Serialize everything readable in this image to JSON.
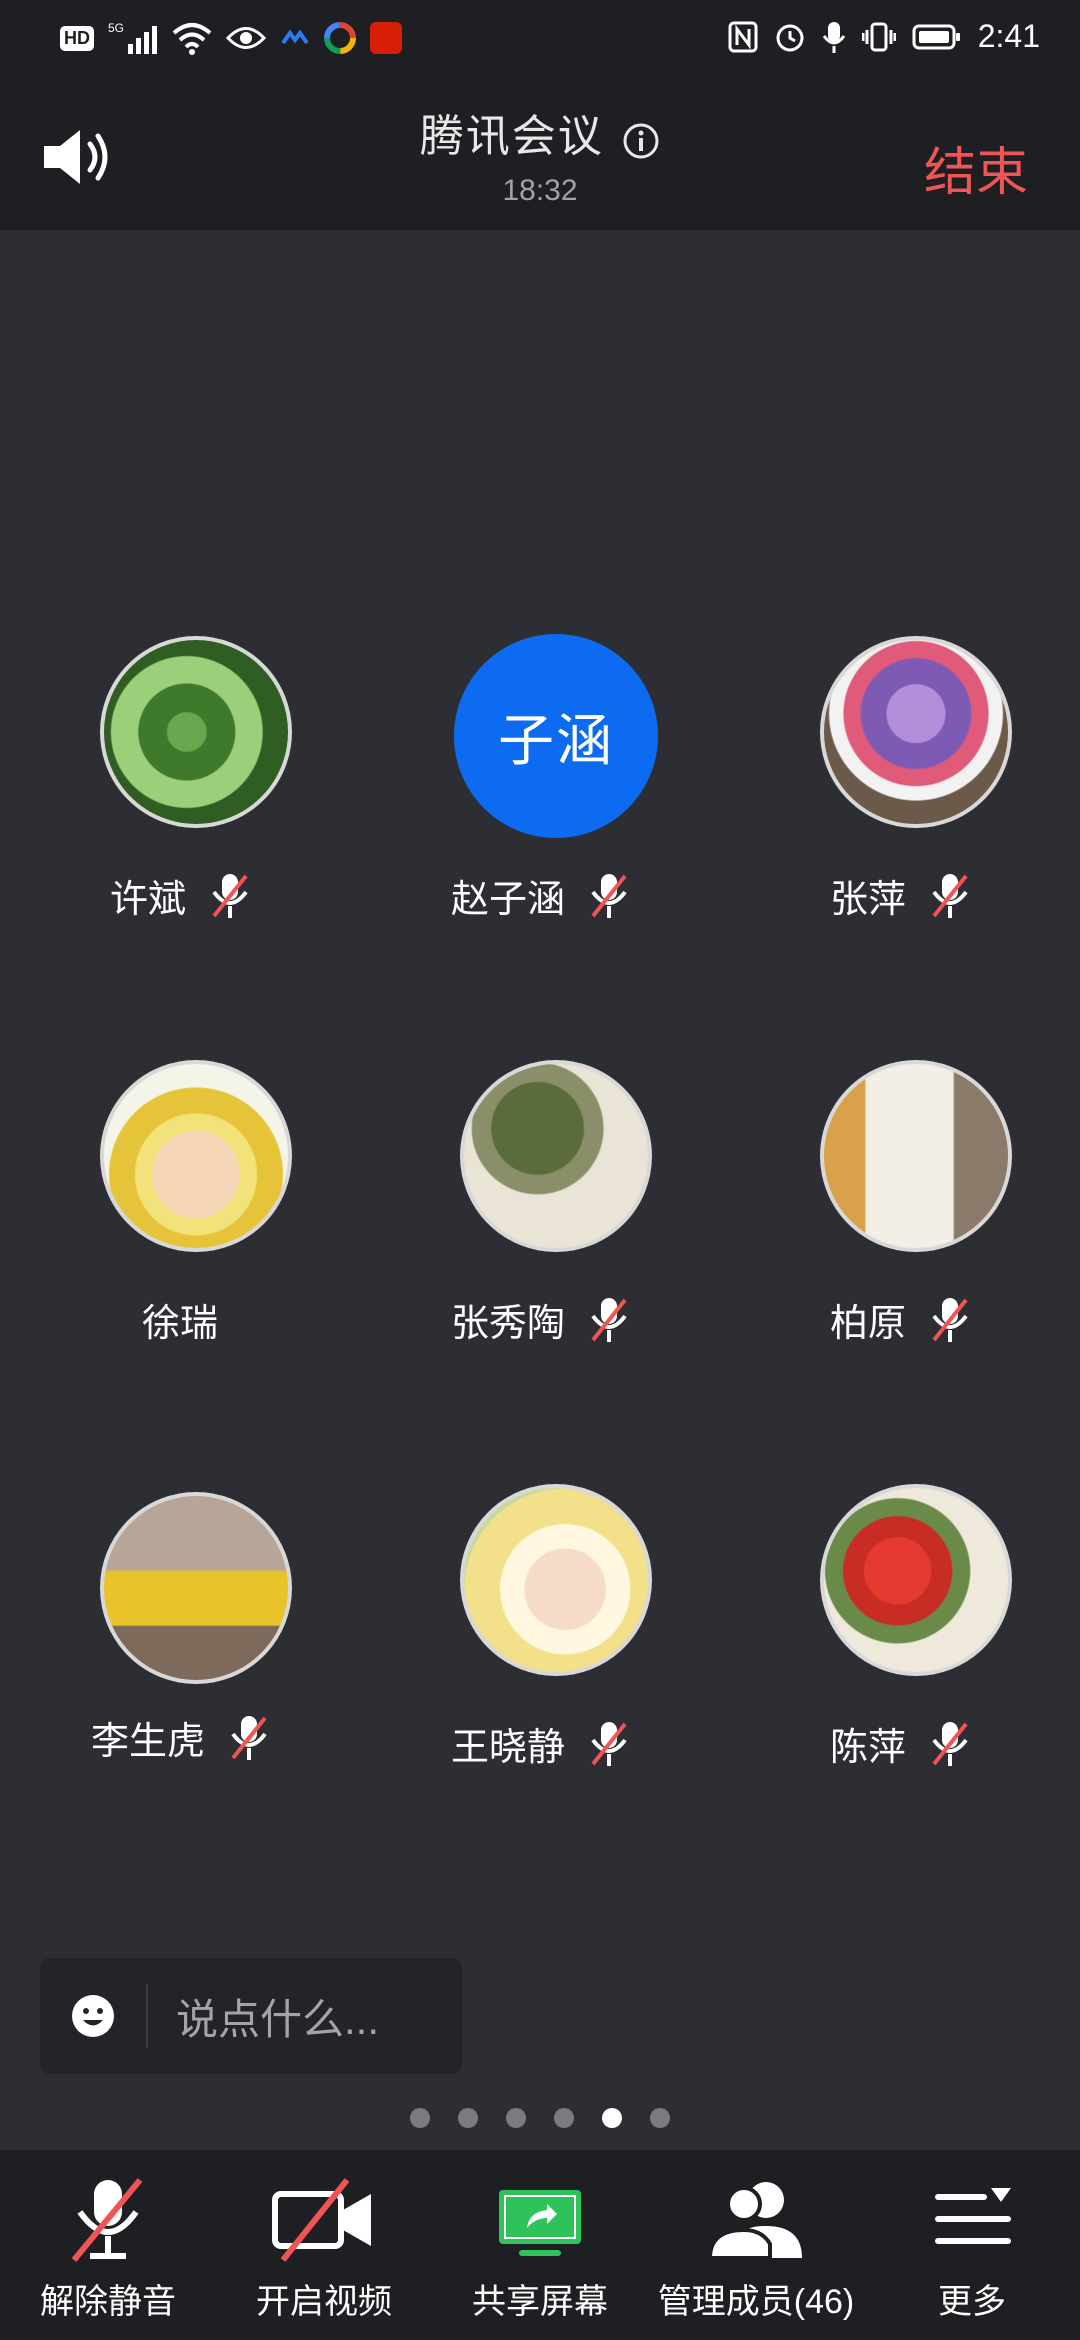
{
  "status_bar": {
    "left_badge": "HD",
    "network": "5G",
    "time": "2:41"
  },
  "header": {
    "title": "腾讯会议",
    "duration": "18:32",
    "end_label": "结束"
  },
  "participants": [
    {
      "name": "许斌",
      "avatar_text": "",
      "muted": true
    },
    {
      "name": "赵子涵",
      "avatar_text": "子涵",
      "muted": true
    },
    {
      "name": "张萍",
      "avatar_text": "",
      "muted": true
    },
    {
      "name": "徐瑞",
      "avatar_text": "",
      "muted": false
    },
    {
      "name": "张秀陶",
      "avatar_text": "",
      "muted": true
    },
    {
      "name": "柏原",
      "avatar_text": "",
      "muted": true
    },
    {
      "name": "李生虎",
      "avatar_text": "",
      "muted": true
    },
    {
      "name": "王晓静",
      "avatar_text": "",
      "muted": true
    },
    {
      "name": "陈萍",
      "avatar_text": "",
      "muted": true
    }
  ],
  "chat": {
    "placeholder": "说点什么..."
  },
  "pagination": {
    "total": 6,
    "current": 5
  },
  "toolbar": {
    "unmute": "解除静音",
    "video": "开启视频",
    "share": "共享屏幕",
    "members": "管理成员(46)",
    "more": "更多"
  },
  "colors": {
    "accent_blue": "#0d6bf2",
    "end_red": "#f05454",
    "share_green": "#2fc25b",
    "mute_red": "#f05454"
  }
}
